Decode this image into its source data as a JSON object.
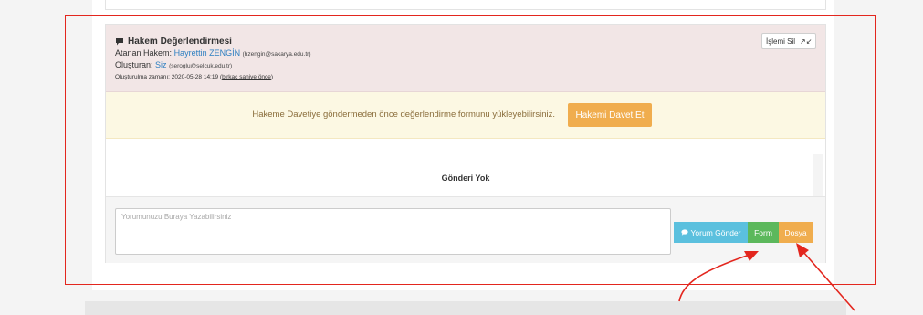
{
  "header": {
    "title": "Hakem Değerlendirmesi",
    "assigned_label": "Atanan Hakem:",
    "assigned_name": "Hayrettin ZENGİN",
    "assigned_email": "(hzengin@sakarya.edu.tr)",
    "creator_label": "Oluşturan:",
    "creator_name": "Siz",
    "creator_email": "(seroglu@selcuk.edu.tr)",
    "created_label": "Oluşturulma zamanı: 2020-05-28 14:19 (",
    "created_relative": "birkaç saniye önce",
    "created_close": ")",
    "delete_button": "İşlemi Sil",
    "expand_icon": "↗↙"
  },
  "alert": {
    "message": "Hakeme Davetiye göndermeden önce değerlendirme formunu yükleyebilirsiniz.",
    "invite_button": "Hakemi Davet Et"
  },
  "messages": {
    "empty_text": "Gönderi Yok"
  },
  "comment": {
    "placeholder": "Yorumunuzu Buraya Yazabilirsiniz",
    "value": "",
    "send_button": "Yorum Gönder",
    "form_button": "Form",
    "file_button": "Dosya"
  },
  "colors": {
    "annotation_red": "#e3261e",
    "warning_orange": "#f0ad4e",
    "success_green": "#5cb85c",
    "info_blue": "#5bc0de",
    "link_blue": "#2d7fc1"
  }
}
